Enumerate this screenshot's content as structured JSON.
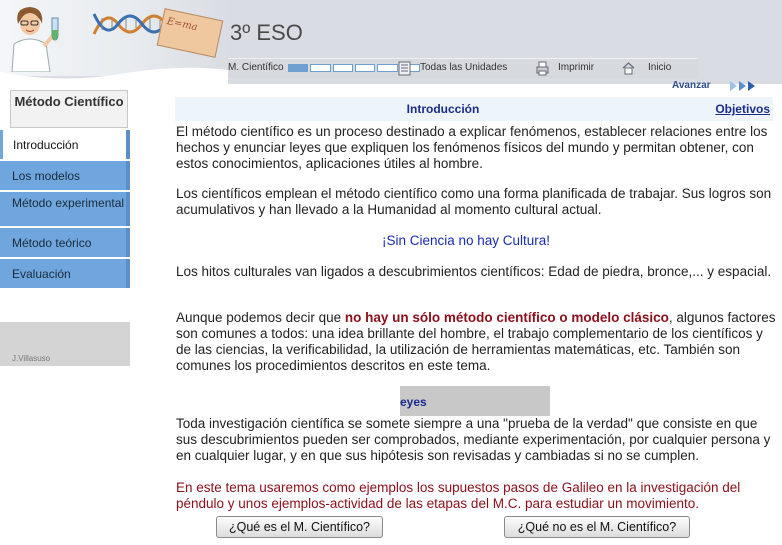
{
  "header": {
    "course": "3º ESO",
    "notebook_text": "E=ma",
    "nav": {
      "metodo_label": "M. Científico",
      "progress": {
        "completed": 1,
        "total": 6
      },
      "unidades_label": "Todas las Unidades",
      "imprimir_label": "Imprimir",
      "inicio_label": "Inicio"
    }
  },
  "sidebar": {
    "title": "Método Científico",
    "items": [
      {
        "label": "Introducción",
        "active": true
      },
      {
        "label": "Los modelos"
      },
      {
        "label": "Método experimental"
      },
      {
        "label": "Método teórico"
      },
      {
        "label": "Evaluación"
      }
    ],
    "credit": "J.Villasuso"
  },
  "nav_forward": {
    "label": "Avanzar"
  },
  "page": {
    "title": "Introducción",
    "objectives_link": "Objetivos",
    "p1": "El método científico es un proceso destinado a explicar fenómenos, establecer relaciones entre los hechos y enunciar leyes que expliquen los fenómenos físicos del mundo y permitan obtener, con estos conocimientos, aplicaciones útiles al hombre.",
    "p2": "Los científicos emplean el método científico como una forma planificada de trabajar. Sus logros son acumulativos y han llevado a la Humanidad al momento cultural actual.",
    "p3": "¡Sin Ciencia no hay Cultura!",
    "p4": "Los hitos culturales van ligados a descubrimientos científicos: Edad de piedra, bronce,... y espacial.",
    "p5_a": "Aunque podemos decir que ",
    "p5_b": "no hay un sólo método científico o modelo clásico",
    "p5_c": ", algunos factores son comunes a todos: una idea brillante del hombre, el trabajo complementario de los científicos y de las ciencias, la verificabilidad, la utilización de herramientas matemáticas, etc. También son comunes los procedimientos descritos en este tema.",
    "leyes": "eyes",
    "p6": "Toda investigación científica se somete siempre a una \"prueba de la verdad\" que consiste en que sus descubrimientos pueden ser comprobados, mediante experimentación, por cualquier persona y en cualquier lugar, y en que sus hipótesis son revisadas y cambiadas si no se cumplen.",
    "p7": "En este tema usaremos como ejemplos los supuestos pasos de Galileo en la investigación del péndulo y unos ejemplos-actividad de las etapas del M.C. para estudiar un movimiento."
  },
  "buttons": {
    "que_es": "¿Qué es el M. Científico?",
    "que_no_es": "¿Qué no es el M. Científico?"
  },
  "colors": {
    "accent_blue": "#6fa6de",
    "title_blue": "#1a2b8c",
    "highlight_red": "#8b0f1a",
    "header_bg": "#d9dde3"
  }
}
